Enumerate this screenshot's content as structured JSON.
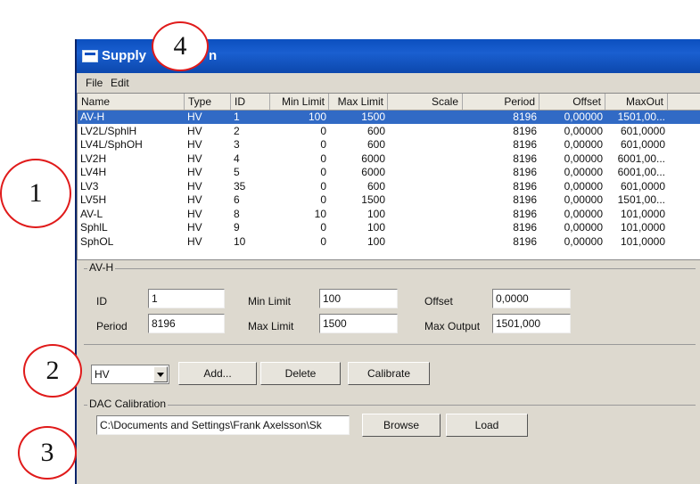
{
  "window": {
    "title_left": "Supply",
    "title_right": "n"
  },
  "menu": [
    "File",
    "Edit"
  ],
  "table": {
    "headers": [
      "Name",
      "Type",
      "ID",
      "Min Limit",
      "Max Limit",
      "Scale",
      "Period",
      "Offset",
      "MaxOut"
    ],
    "rows": [
      [
        "AV-H",
        "HV",
        "1",
        "100",
        "1500",
        "",
        "8196",
        "0,00000",
        "1501,00..."
      ],
      [
        "LV2L/SphlH",
        "HV",
        "2",
        "0",
        "600",
        "",
        "8196",
        "0,00000",
        "601,0000"
      ],
      [
        "LV4L/SphOH",
        "HV",
        "3",
        "0",
        "600",
        "",
        "8196",
        "0,00000",
        "601,0000"
      ],
      [
        "LV2H",
        "HV",
        "4",
        "0",
        "6000",
        "",
        "8196",
        "0,00000",
        "6001,00..."
      ],
      [
        "LV4H",
        "HV",
        "5",
        "0",
        "6000",
        "",
        "8196",
        "0,00000",
        "6001,00..."
      ],
      [
        "LV3",
        "HV",
        "35",
        "0",
        "600",
        "",
        "8196",
        "0,00000",
        "601,0000"
      ],
      [
        "LV5H",
        "HV",
        "6",
        "0",
        "1500",
        "",
        "8196",
        "0,00000",
        "1501,00..."
      ],
      [
        "AV-L",
        "HV",
        "8",
        "10",
        "100",
        "",
        "8196",
        "0,00000",
        "101,0000"
      ],
      [
        "SphlL",
        "HV",
        "9",
        "0",
        "100",
        "",
        "8196",
        "0,00000",
        "101,0000"
      ],
      [
        "SphOL",
        "HV",
        "10",
        "0",
        "100",
        "",
        "8196",
        "0,00000",
        "101,0000"
      ]
    ]
  },
  "details": {
    "group_label": "AV-H",
    "id_label": "ID",
    "id_value": "1",
    "period_label": "Period",
    "period_value": "8196",
    "min_limit_label": "Min Limit",
    "min_limit_value": "100",
    "max_limit_label": "Max Limit",
    "max_limit_value": "1500",
    "offset_label": "Offset",
    "offset_value": "0,0000",
    "max_output_label": "Max Output",
    "max_output_value": "1501,000"
  },
  "actions": {
    "type_value": "HV",
    "add_label": "Add...",
    "delete_label": "Delete",
    "calibrate_label": "Calibrate"
  },
  "dac": {
    "group_label": "DAC Calibration",
    "path_value": "C:\\Documents and Settings\\Frank Axelsson\\Sk",
    "browse_label": "Browse",
    "load_label": "Load"
  },
  "callouts": [
    "4",
    "1",
    "2",
    "3"
  ],
  "colors": {
    "titlebar": "#0b4fbf",
    "selection": "#316ac5",
    "callout_ring": "#e01a1a"
  }
}
